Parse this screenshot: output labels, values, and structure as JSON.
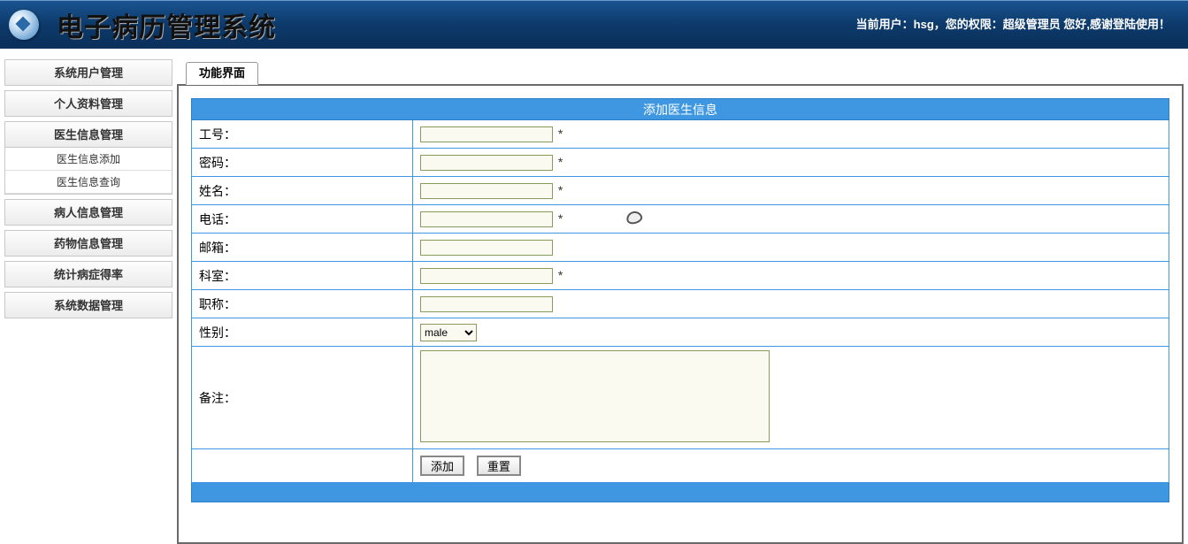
{
  "header": {
    "title": "电子病历管理系统",
    "user_info": "当前用户：hsg，您的权限：超级管理员  您好,感谢登陆使用！"
  },
  "sidebar": {
    "items": [
      {
        "label": "系统用户管理",
        "type": "main"
      },
      {
        "label": "个人资料管理",
        "type": "main"
      },
      {
        "label": "医生信息管理",
        "type": "main"
      },
      {
        "label": "医生信息添加",
        "type": "sub"
      },
      {
        "label": "医生信息查询",
        "type": "sub"
      },
      {
        "label": "病人信息管理",
        "type": "main"
      },
      {
        "label": "药物信息管理",
        "type": "main"
      },
      {
        "label": "统计病症得率",
        "type": "main"
      },
      {
        "label": "系统数据管理",
        "type": "main"
      }
    ]
  },
  "tab": {
    "label": "功能界面"
  },
  "form": {
    "title": "添加医生信息",
    "fields": {
      "staff_id": {
        "label": "工号：",
        "value": "",
        "required": true
      },
      "password": {
        "label": "密码：",
        "value": "",
        "required": true
      },
      "name": {
        "label": "姓名：",
        "value": "",
        "required": true
      },
      "phone": {
        "label": "电话：",
        "value": "",
        "required": true
      },
      "email": {
        "label": "邮箱：",
        "value": "",
        "required": false
      },
      "department": {
        "label": "科室：",
        "value": "",
        "required": true
      },
      "title": {
        "label": "职称：",
        "value": "",
        "required": false
      },
      "gender": {
        "label": "性别：",
        "selected": "male"
      },
      "note": {
        "label": "备注：",
        "value": ""
      }
    },
    "required_marker": "*",
    "buttons": {
      "submit": "添加",
      "reset": "重置"
    }
  }
}
